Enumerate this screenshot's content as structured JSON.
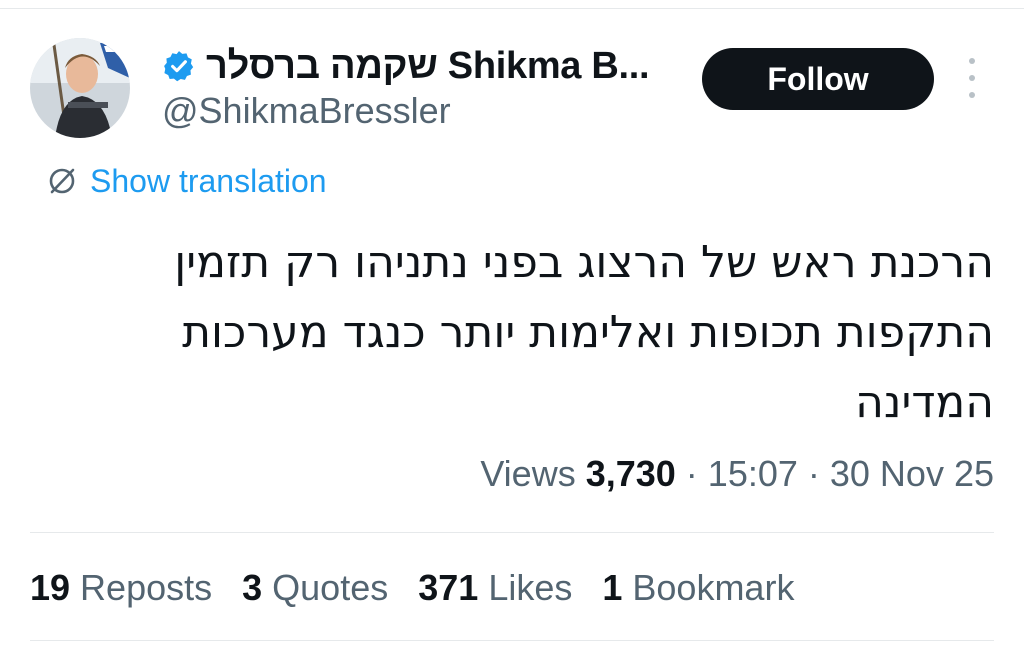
{
  "tweet": {
    "author": {
      "display_name": "שקמה ברסלר Shikma B...",
      "handle": "@ShikmaBressler",
      "verified_icon": "verified-badge-icon",
      "avatar_icon": "avatar-photo"
    },
    "follow_label": "Follow",
    "more_icon": "more-vertical-icon",
    "show_translation_label": "Show translation",
    "translate_icon": "translate-icon",
    "text_lines": [
      "הרכנת ראש של הרצוג בפני נתניהו רק תזמין",
      "התקפות תכופות ואלימות יותר כנגד מערכות",
      "המדינה"
    ],
    "meta": {
      "views_label": "Views",
      "views_count": "3,730",
      "time": "15:07",
      "date": "30 Nov 25",
      "separator": "·"
    },
    "stats": [
      {
        "count": "19",
        "label": "Reposts"
      },
      {
        "count": "3",
        "label": "Quotes"
      },
      {
        "count": "371",
        "label": "Likes"
      },
      {
        "count": "1",
        "label": "Bookmark"
      }
    ],
    "colors": {
      "link": "#1d9bf0",
      "secondary_text": "#536471",
      "primary_text": "#0f1419",
      "follow_bg": "#0f1419"
    }
  }
}
